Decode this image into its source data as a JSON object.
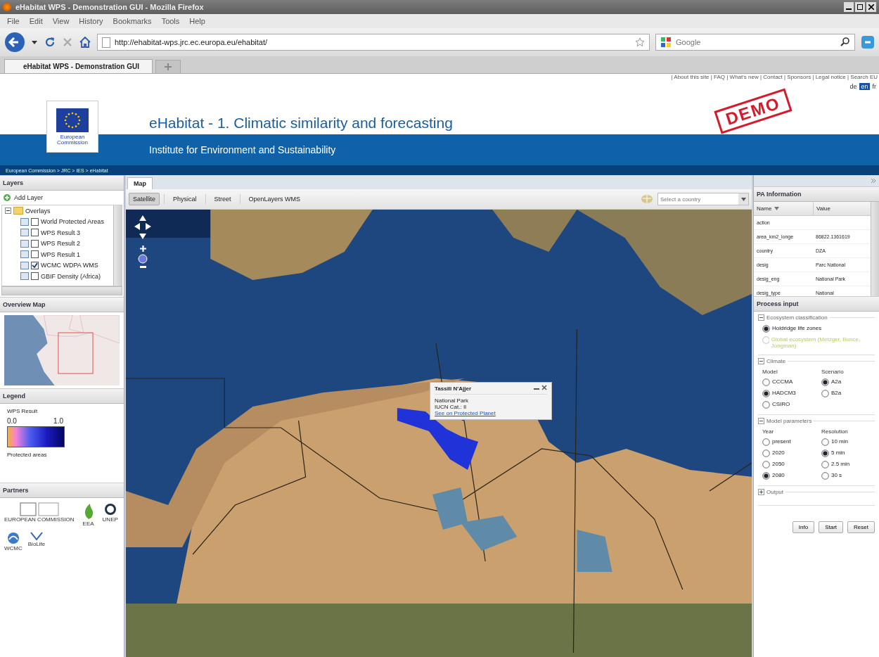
{
  "browser": {
    "title": "eHabitat WPS - Demonstration GUI - Mozilla Firefox",
    "menu": [
      "File",
      "Edit",
      "View",
      "History",
      "Bookmarks",
      "Tools",
      "Help"
    ],
    "url": "http://ehabitat-wps.jrc.ec.europa.eu/ehabitat/",
    "search_placeholder": "Google",
    "tabs": [
      {
        "label": "eHabitat WPS - Demonstration GUI",
        "selected": true
      }
    ]
  },
  "header": {
    "top_links": "| About this site | FAQ | What's new | Contact | Sponsors | Legal notice | Search EU",
    "languages": [
      {
        "label": "de",
        "selected": false
      },
      {
        "label": "en",
        "selected": true
      },
      {
        "label": "fr",
        "selected": false
      }
    ],
    "logo_caption": "European Commission",
    "title": "eHabitat - 1. Climatic similarity and forecasting",
    "subtitle": "Institute for Environment and Sustainability",
    "stamp": "DEMO",
    "breadcrumb": "European Commission > JRC > IES > eHabitat"
  },
  "layers": {
    "title": "Layers",
    "add_button": "Add Layer",
    "tree": [
      {
        "label": "Overlays",
        "expanded": true,
        "children": [
          {
            "label": "World Protected Areas",
            "checked": false
          },
          {
            "label": "WPS Result 3",
            "checked": false
          },
          {
            "label": "WPS Result 2",
            "checked": false
          },
          {
            "label": "WPS Result 1",
            "checked": false
          },
          {
            "label": "WCMC WDPA WMS",
            "checked": true
          },
          {
            "label": "GBIF Density (Africa)",
            "checked": false
          }
        ]
      }
    ]
  },
  "overview": {
    "title": "Overview Map"
  },
  "legend": {
    "title": "Legend",
    "layer": "WPS Result",
    "min": "0.0",
    "max": "1.0",
    "note": "Protected areas"
  },
  "partners": {
    "title": "Partners",
    "logos": [
      {
        "kind": "jrc",
        "label": "EUROPEAN COMMISSION"
      },
      {
        "kind": "leaf",
        "label": "EEA"
      },
      {
        "kind": "globe",
        "label": "UNEP"
      },
      {
        "kind": "wcmc",
        "label": "WCMC"
      },
      {
        "kind": "biolife",
        "label": "BioLife"
      }
    ]
  },
  "map": {
    "tab": "Map",
    "base_layers": [
      {
        "label": "Satellite",
        "selected": true
      },
      {
        "label": "Physical",
        "selected": false
      },
      {
        "label": "Street",
        "selected": false
      },
      {
        "label": "OpenLayers WMS",
        "selected": false
      }
    ],
    "country_placeholder": "Select a country",
    "popup": {
      "title": "Tassili N'Ajjer",
      "lines": [
        "National Park",
        "IUCN Cat.: II"
      ],
      "link": "See on Protected Planet"
    }
  },
  "pa_info": {
    "title": "PA Information",
    "columns": [
      "Name",
      "Value"
    ],
    "rows": [
      [
        "action",
        ""
      ],
      [
        "area_km2_longe",
        "86822.1361619"
      ],
      [
        "country",
        "DZA"
      ],
      [
        "desig",
        "Parc National"
      ],
      [
        "desig_eng",
        "National Park"
      ],
      [
        "desig_type",
        "National"
      ]
    ]
  },
  "process": {
    "title": "Process input",
    "sections": [
      {
        "legend": "Ecosystem classification",
        "expanded": true,
        "groups": [
          {
            "options": [
              {
                "label": "Holdridge life zones",
                "selected": true,
                "disabled": false
              },
              {
                "label": "Global ecosystem (Metzger, Bunce, Jongman)",
                "selected": false,
                "disabled": true
              }
            ]
          }
        ]
      },
      {
        "legend": "Climate",
        "expanded": true,
        "groups": [
          {
            "label": "Model",
            "options": [
              {
                "label": "CCCMA",
                "selected": false,
                "disabled": false
              },
              {
                "label": "HADCM3",
                "selected": true,
                "disabled": false
              },
              {
                "label": "CSIRO",
                "selected": false,
                "disabled": false
              }
            ]
          },
          {
            "label": "Scenario",
            "options": [
              {
                "label": "A2a",
                "selected": true,
                "disabled": false
              },
              {
                "label": "B2a",
                "selected": false,
                "disabled": false
              }
            ]
          }
        ]
      },
      {
        "legend": "Model parameters",
        "expanded": true,
        "groups": [
          {
            "label": "Year",
            "options": [
              {
                "label": "present",
                "selected": false,
                "disabled": false
              },
              {
                "label": "2020",
                "selected": false,
                "disabled": false
              },
              {
                "label": "2050",
                "selected": false,
                "disabled": false
              },
              {
                "label": "2080",
                "selected": true,
                "disabled": false
              }
            ]
          },
          {
            "label": "Resolution",
            "options": [
              {
                "label": "10 min",
                "selected": false,
                "disabled": false
              },
              {
                "label": "5 min",
                "selected": true,
                "disabled": false
              },
              {
                "label": "2.5 min",
                "selected": false,
                "disabled": false
              },
              {
                "label": "30 s",
                "selected": false,
                "disabled": false
              }
            ]
          }
        ]
      },
      {
        "legend": "Output",
        "expanded": false
      }
    ],
    "buttons": [
      "Info",
      "Start",
      "Reset"
    ]
  }
}
